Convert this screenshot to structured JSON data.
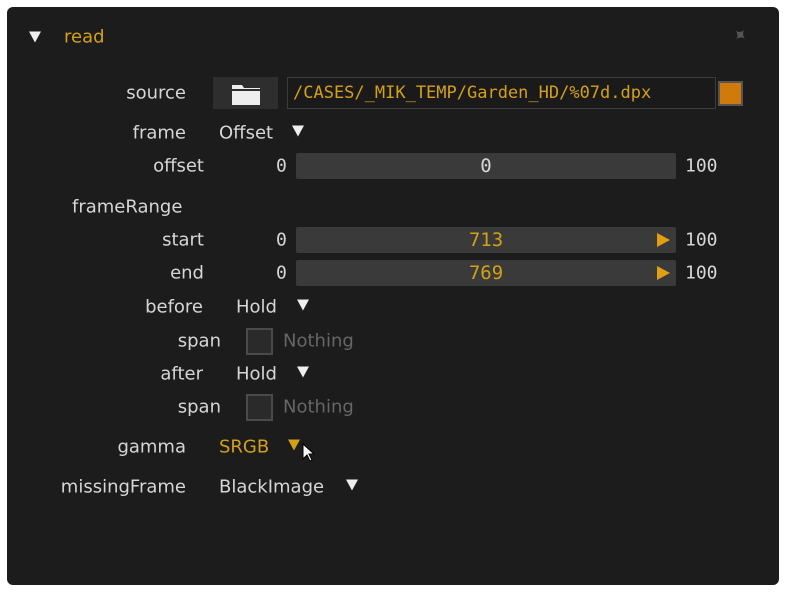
{
  "header": {
    "title": "read"
  },
  "source": {
    "label": "source",
    "path": "/CASES/_MIK_TEMP/Garden_HD/%07d.dpx"
  },
  "frame": {
    "label": "frame",
    "value": "Offset"
  },
  "offset": {
    "label": "offset",
    "min": "0",
    "value": "0",
    "max": "100"
  },
  "frameRange": {
    "label": "frameRange",
    "start": {
      "label": "start",
      "min": "0",
      "value": "713",
      "max": "100"
    },
    "end": {
      "label": "end",
      "min": "0",
      "value": "769",
      "max": "100"
    }
  },
  "before": {
    "label": "before",
    "value": "Hold",
    "span_label": "span",
    "span_value": "Nothing"
  },
  "after": {
    "label": "after",
    "value": "Hold",
    "span_label": "span",
    "span_value": "Nothing"
  },
  "gamma": {
    "label": "gamma",
    "value": "SRGB"
  },
  "missingFrame": {
    "label": "missingFrame",
    "value": "BlackImage"
  },
  "colors": {
    "accent": "#d4a017",
    "panel": "#1c1c1c",
    "field": "#3a3a3a"
  }
}
